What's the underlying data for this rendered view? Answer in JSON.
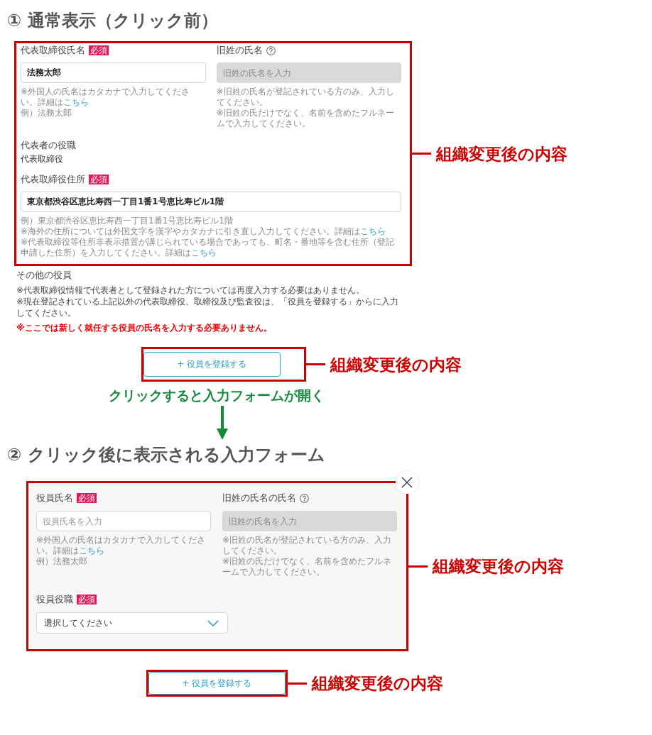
{
  "section_1": {
    "heading": "① 通常表示（クリック前）",
    "callout": "組織変更後の内容",
    "rows": [
      [
        {
          "kind": "input",
          "label": "代表取締役氏名",
          "badge": "必須",
          "value": "法務太郎",
          "disabled": false,
          "notes": [
            {
              "text": "※外国人の氏名はカタカナで入力してください。詳細は",
              "link": "こちら"
            },
            {
              "text": "例）法務太郎"
            }
          ]
        },
        {
          "kind": "input",
          "label": "旧姓の氏名",
          "help": true,
          "placeholder": "旧姓の氏名を入力",
          "disabled": true,
          "notes": [
            {
              "text": "※旧姓の氏名が登記されている方のみ、入力してください。"
            },
            {
              "text": "※旧姓の氏だけでなく、名前を含めたフルネームで入力してください。"
            }
          ]
        }
      ],
      [
        {
          "kind": "static",
          "label": "代表者の役職",
          "value": "代表取締役"
        }
      ],
      [
        {
          "kind": "input",
          "label": "代表取締役住所",
          "badge": "必須",
          "value": "東京都渋谷区恵比寿西一丁目1番1号恵比寿ビル1階",
          "disabled": false,
          "notes": [
            {
              "text": "例）東京都渋谷区恵比寿西一丁目1番1号恵比寿ビル1階"
            },
            {
              "text": "※海外の住所については外国文字を漢字やカタカナに引き直し入力してください。詳細は",
              "link": "こちら"
            },
            {
              "text": "※代表取締役等住所非表示措置が講じられている場合であっても、町名・番地等を含む住所（登記申請した住所）を入力してください。詳細は",
              "link": "こちら"
            }
          ]
        }
      ]
    ],
    "other_officers": {
      "label": "その他の役員",
      "notes": [
        "※代表取締役情報で代表者として登録された方については再度入力する必要はありません。",
        "※現在登記されている上記以外の代表取締役、取締役及び監査役は、「役員を登録する」からに入力してください。"
      ],
      "warning": "※ここでは新しく就任する役員の氏名を入力する必要ありません。"
    },
    "add_button": {
      "label": "+ 役員を登録する",
      "callout": "組織変更後の内容"
    }
  },
  "transition": {
    "label": "クリックすると入力フォームが開く"
  },
  "section_2": {
    "heading": "② クリック後に表示される入力フォーム",
    "callout": "組織変更後の内容",
    "rows": [
      [
        {
          "kind": "input",
          "label": "役員氏名",
          "badge": "必須",
          "placeholder": "役員氏名を入力",
          "disabled": false,
          "notes": [
            {
              "text": "※外国人の氏名はカタカナで入力してください。詳細は",
              "link": "こちら"
            },
            {
              "text": "例）法務太郎"
            }
          ]
        },
        {
          "kind": "input",
          "label": "旧姓の氏名の氏名",
          "help": true,
          "placeholder": "旧姓の氏名を入力",
          "disabled": true,
          "notes": [
            {
              "text": "※旧姓の氏名が登記されている方のみ、入力してください。"
            },
            {
              "text": "※旧姓の氏だけでなく、名前を含めたフルネームで入力してください。"
            }
          ]
        }
      ],
      [
        {
          "kind": "select",
          "label": "役員役職",
          "badge": "必須",
          "value": "選択してください"
        }
      ]
    ],
    "add_button": {
      "label": "+ 役員を登録する",
      "callout": "組織変更後の内容"
    }
  }
}
